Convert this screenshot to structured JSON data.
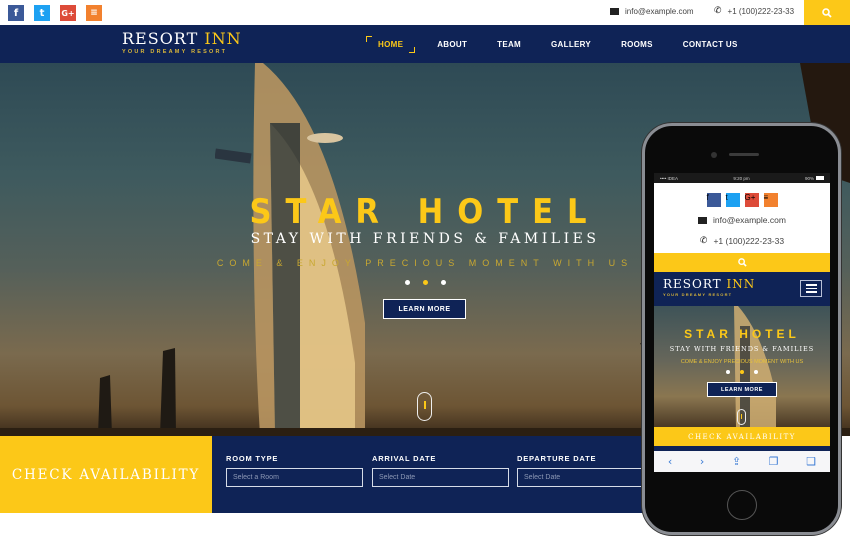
{
  "topbar": {
    "social": [
      {
        "name": "facebook",
        "glyph": "f"
      },
      {
        "name": "twitter",
        "glyph": "t"
      },
      {
        "name": "google-plus",
        "glyph": "G+"
      },
      {
        "name": "rss",
        "glyph": "≡"
      }
    ],
    "email": "info@example.com",
    "phone": "+1 (100)222-23-33",
    "search_icon": "search-icon"
  },
  "brand": {
    "name_main": "RESORT",
    "name_accent": "INN",
    "tagline": "YOUR DREAMY RESORT"
  },
  "nav": {
    "items": [
      "HOME",
      "ABOUT",
      "TEAM",
      "GALLERY",
      "ROOMS",
      "CONTACT US"
    ],
    "active": "HOME"
  },
  "hero": {
    "title": "STAR HOTEL",
    "subtitle": "STAY WITH FRIENDS & FAMILIES",
    "tagline": "COME & ENJOY PRECIOUS MOMENT WITH US",
    "slides": 3,
    "active_slide": 2,
    "button": "LEARN MORE"
  },
  "availability": {
    "heading": "CHECK AVAILABILITY",
    "fields": [
      {
        "label": "ROOM TYPE",
        "placeholder": "Select a Room"
      },
      {
        "label": "ARRIVAL DATE",
        "placeholder": "Select Date"
      },
      {
        "label": "DEPARTURE DATE",
        "placeholder": "Select Date"
      }
    ]
  },
  "mobile": {
    "status": {
      "carrier": "•••• IDEA",
      "time": "9:20 pm",
      "battery": "90%"
    },
    "email": "info@example.com",
    "phone": "+1 (100)222-23-33",
    "title": "STAR HOTEL",
    "subtitle": "STAY WITH FRIENDS & FAMILIES",
    "tagline": "COME & ENJOY PRECIOUS MOMENT WITH US",
    "button": "LEARN MORE",
    "check": "CHECK AVAILABILITY",
    "toolbar": [
      "‹",
      "›",
      "⇪",
      "❐",
      "❑"
    ]
  },
  "colors": {
    "navy": "#0f2356",
    "yellow": "#fcc818",
    "facebook": "#3b5998",
    "twitter": "#1da1f2",
    "google": "#dd4b39",
    "rss": "#f2812e"
  }
}
